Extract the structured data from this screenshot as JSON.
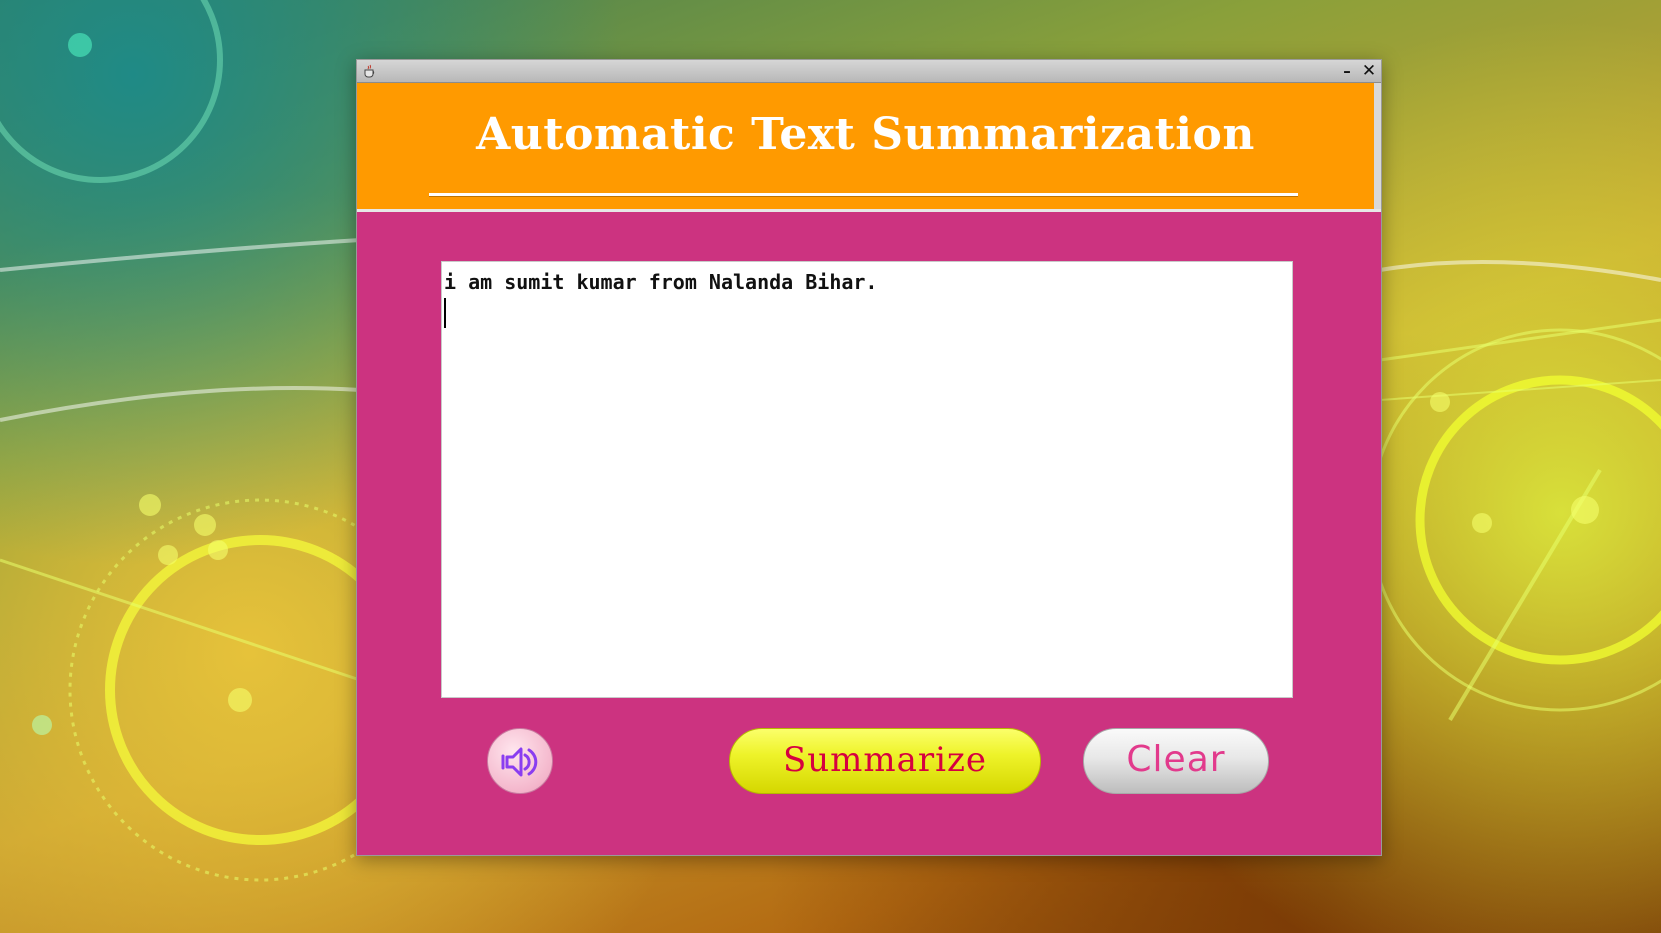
{
  "app": {
    "title": "Automatic Text Summarization"
  },
  "editor": {
    "text": "i am sumit kumar from Nalanda Bihar."
  },
  "buttons": {
    "summarize_label": "Summarize",
    "clear_label": "Clear"
  },
  "icons": {
    "app": "java-cup-icon",
    "minimize": "minimize-icon",
    "close": "close-icon",
    "speaker": "speaker-icon"
  },
  "colors": {
    "header": "#ff9a00",
    "panel": "#cc3380",
    "summarize_bg": "#eef32a",
    "summarize_text": "#d60040",
    "clear_text": "#e23a8c"
  }
}
